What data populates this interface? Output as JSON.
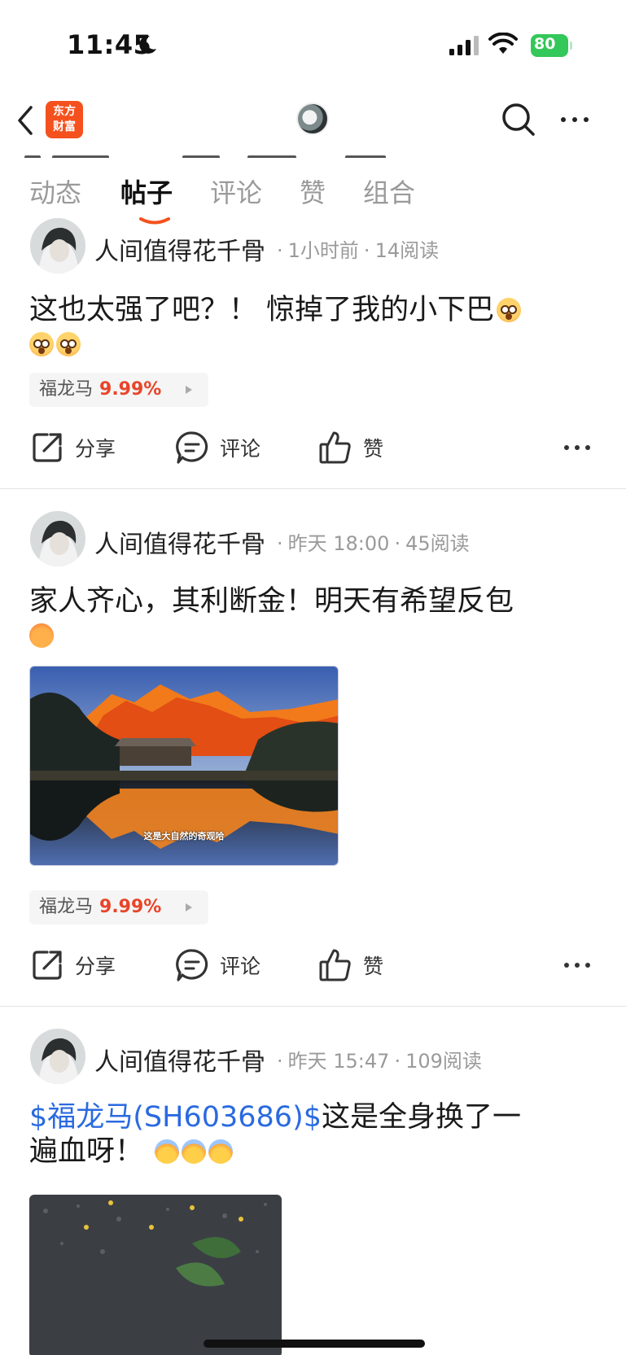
{
  "status_bar": {
    "time": "11:45",
    "battery": "80"
  },
  "header": {
    "logo_line1": "东方",
    "logo_line2": "财富"
  },
  "tabs": [
    {
      "label": "动态"
    },
    {
      "label": "帖子"
    },
    {
      "label": "评论"
    },
    {
      "label": "赞"
    },
    {
      "label": "组合"
    }
  ],
  "actions": {
    "share": "分享",
    "comment": "评论",
    "like": "赞"
  },
  "posts": [
    {
      "author": "人间值得花千骨",
      "time": "1小时前",
      "reads": "14阅读",
      "text": "这也太强了吧？！ 惊掉了我的小下巴",
      "stock_name": "福龙马",
      "stock_pct": "9.99%"
    },
    {
      "author": "人间值得花千骨",
      "time": "昨天 18:00",
      "reads": "45阅读",
      "text": "家人齐心，其利断金！明天有希望反包",
      "image_caption": "这是大自然的奇观哈",
      "stock_name": "福龙马",
      "stock_pct": "9.99%"
    },
    {
      "author": "人间值得花千骨",
      "time": "昨天 15:47",
      "reads": "109阅读",
      "link_text": "$福龙马(SH603686)$",
      "text_line1": "这是全身换了一",
      "text_line2": "遍血呀！"
    }
  ]
}
